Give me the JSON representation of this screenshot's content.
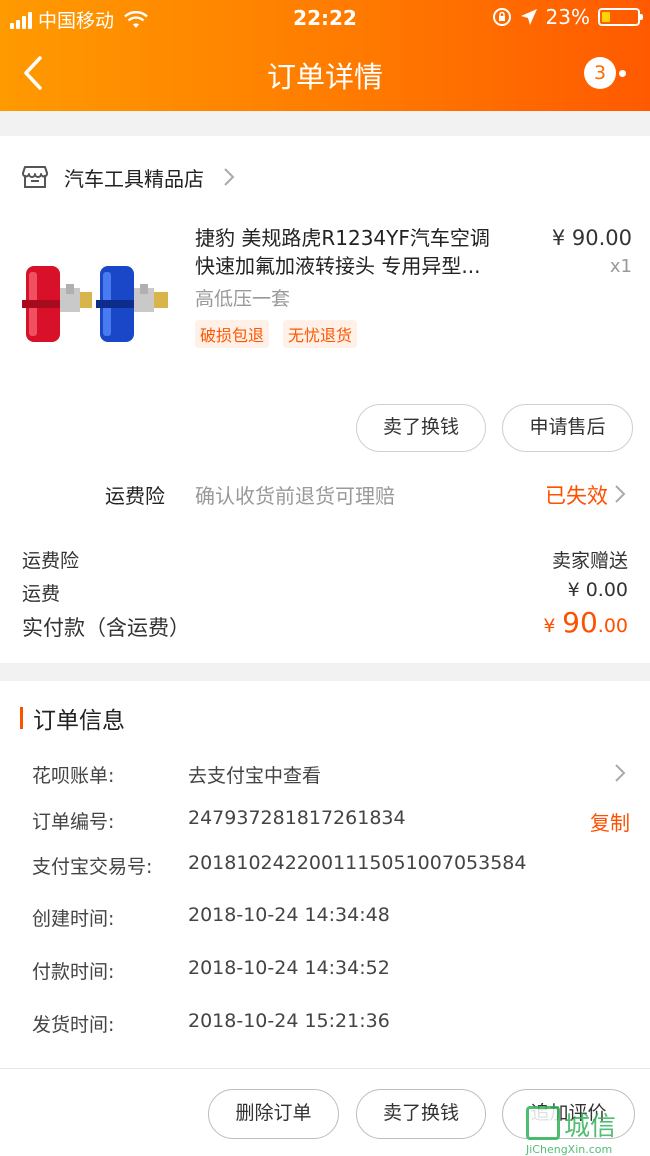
{
  "status_bar": {
    "carrier": "中国移动",
    "time": "22:22",
    "battery_percent": "23%",
    "battery_level": 0.23
  },
  "navbar": {
    "title": "订单详情",
    "badge_count": "3",
    "back_icon": "chevron-left-icon",
    "more_icon": "more-dots-icon"
  },
  "shop": {
    "name": "汽车工具精品店",
    "icon": "store-icon"
  },
  "product": {
    "title_line1": "捷豹 美规路虎R1234YF汽车空调",
    "title_line2": "快速加氟加液转接头 专用异型...",
    "sku": "高低压一套",
    "tags": [
      "破损包退",
      "无忧退货"
    ],
    "price": "¥ 90.00",
    "quantity": "x1"
  },
  "item_actions": {
    "sell_label": "卖了换钱",
    "after_sale_label": "申请售后"
  },
  "shipping_insurance": {
    "label": "运费险",
    "desc": "确认收货前退货可理赔",
    "status": "已失效"
  },
  "fees": {
    "insurance_label": "运费险",
    "insurance_value": "卖家赠送",
    "shipping_label": "运费",
    "shipping_value": "¥ 0.00",
    "total_label": "实付款（含运费）",
    "total_currency": "¥",
    "total_integer": "90",
    "total_decimal": ".00"
  },
  "order_info": {
    "section_title": "订单信息",
    "huabei_label": "花呗账单:",
    "huabei_value": "去支付宝中查看",
    "order_no_label": "订单编号:",
    "order_no_value": "247937281817261834",
    "copy_label": "复制",
    "alipay_label": "支付宝交易号:",
    "alipay_value": "2018102422001115051007053584",
    "created_label": "创建时间:",
    "created_value": "2018-10-24 14:34:48",
    "paid_label": "付款时间:",
    "paid_value": "2018-10-24 14:34:52",
    "shipped_label": "发货时间:",
    "shipped_value": "2018-10-24 15:21:36"
  },
  "bottom_actions": {
    "delete_label": "删除订单",
    "sell_label": "卖了换钱",
    "review_label": "追加评价"
  },
  "watermark": {
    "chars": "城信",
    "url": "JiChengXin.com"
  },
  "colors": {
    "accent": "#ff5000",
    "header_start": "#ff9a00",
    "header_end": "#ff5a00"
  }
}
